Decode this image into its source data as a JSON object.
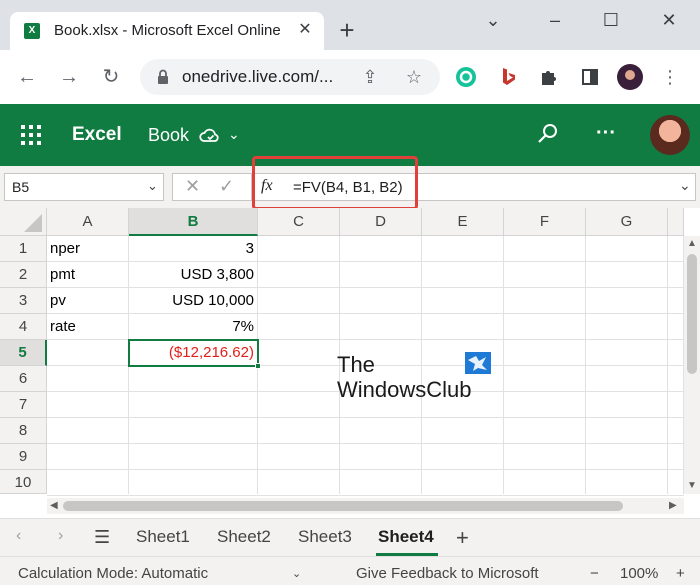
{
  "browser": {
    "tab_title": "Book.xlsx - Microsoft Excel Online",
    "tab_close": "✕",
    "new_tab": "+",
    "url": "onedrive.live.com/...",
    "window_controls": [
      "⌄",
      "–",
      "☐",
      "✕"
    ]
  },
  "excel": {
    "app_name": "Excel",
    "doc_name": "Book",
    "search_icon": "search-icon",
    "more_label": "···"
  },
  "formula_bar": {
    "name_box": "B5",
    "fx_label": "fx",
    "formula": "=FV(B4, B1, B2)"
  },
  "grid": {
    "columns": [
      "A",
      "B",
      "C",
      "D",
      "E",
      "F",
      "G"
    ],
    "rows": [
      "1",
      "2",
      "3",
      "4",
      "5",
      "6",
      "7",
      "8",
      "9",
      "10"
    ],
    "cells": {
      "A1": "nper",
      "B1": "3",
      "A2": "pmt",
      "B2": "USD 3,800",
      "A3": "pv",
      "B3": "USD 10,000",
      "A4": "rate",
      "B4": "7%",
      "B5": "($12,216.62)"
    },
    "selected_cell": "B5"
  },
  "watermark": {
    "line1": "The",
    "line2": "WindowsClub"
  },
  "sheets": {
    "tabs": [
      "Sheet1",
      "Sheet2",
      "Sheet3",
      "Sheet4"
    ],
    "active": "Sheet4",
    "add_label": "+"
  },
  "status": {
    "calc_mode": "Calculation Mode: Automatic",
    "feedback": "Give Feedback to Microsoft",
    "zoom": "100%",
    "zoom_minus": "−",
    "zoom_plus": "+"
  },
  "colors": {
    "excel_green": "#107c41",
    "highlight_red": "#e0403a",
    "negative_red": "#e0201a"
  }
}
